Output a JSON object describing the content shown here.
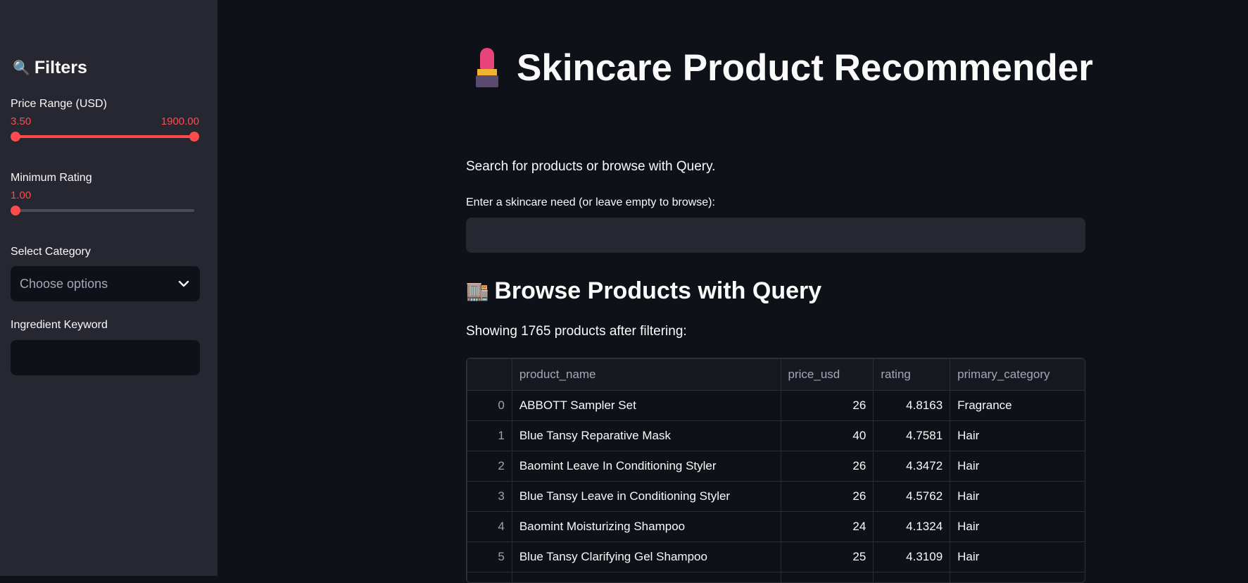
{
  "sidebar": {
    "title": "Filters",
    "title_icon": "🔍",
    "price": {
      "label": "Price Range (USD)",
      "min_label": "3.50",
      "max_label": "1900.00",
      "min_fraction": 0.0,
      "max_fraction": 1.0
    },
    "rating": {
      "label": "Minimum Rating",
      "value_label": "1.00",
      "fraction": 0.0
    },
    "category": {
      "label": "Select Category",
      "placeholder": "Choose options"
    },
    "ingredient": {
      "label": "Ingredient Keyword",
      "value": ""
    }
  },
  "main": {
    "title": "Skincare Product Recommender",
    "title_icon": "lipstick-icon",
    "intro": "Search for products or browse with Query.",
    "query_label": "Enter a skincare need (or leave empty to browse):",
    "query_value": "",
    "section_title": "Browse Products with Query",
    "section_icon": "🏬",
    "showing_text": "Showing 1765 products after filtering:"
  },
  "table": {
    "columns": [
      "",
      "product_name",
      "price_usd",
      "rating",
      "primary_category"
    ],
    "rows": [
      [
        "0",
        "ABBOTT Sampler Set",
        "26",
        "4.8163",
        "Fragrance"
      ],
      [
        "1",
        "Blue Tansy Reparative Mask",
        "40",
        "4.7581",
        "Hair"
      ],
      [
        "2",
        "Baomint Leave In Conditioning Styler",
        "26",
        "4.3472",
        "Hair"
      ],
      [
        "3",
        "Blue Tansy Leave in Conditioning Styler",
        "26",
        "4.5762",
        "Hair"
      ],
      [
        "4",
        "Baomint Moisturizing Shampoo",
        "24",
        "4.1324",
        "Hair"
      ],
      [
        "5",
        "Blue Tansy Clarifying Gel Shampoo",
        "25",
        "4.3109",
        "Hair"
      ],
      [
        "6",
        "",
        "",
        "",
        ""
      ]
    ]
  },
  "colors": {
    "accent": "#ff4b4b",
    "sidebar_bg": "#262730",
    "main_bg": "#0e1117"
  }
}
